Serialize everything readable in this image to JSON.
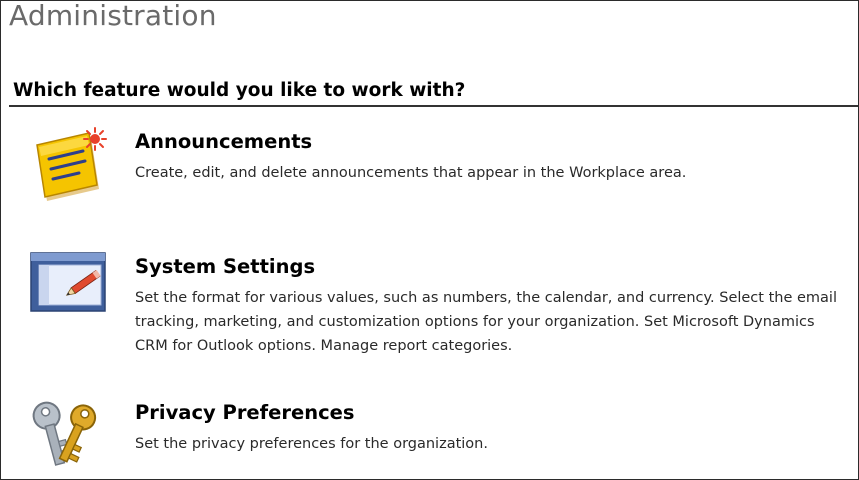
{
  "page": {
    "title": "Administration",
    "section_heading": "Which feature would you like to work with?"
  },
  "features": [
    {
      "icon": "announcements-note-icon",
      "title": "Announcements",
      "description": "Create, edit, and delete announcements that appear in the Workplace area."
    },
    {
      "icon": "system-settings-window-icon",
      "title": "System Settings",
      "description": "Set the format for various values, such as numbers, the calendar, and currency. Select the email tracking, marketing, and customization options for your organization. Set Microsoft Dynamics CRM for Outlook options. Manage report categories."
    },
    {
      "icon": "privacy-keys-icon",
      "title": "Privacy Preferences",
      "description": "Set the privacy preferences for the organization."
    }
  ],
  "colors": {
    "title_gray": "#6a6a6a",
    "heading_black": "#000000",
    "note_yellow": "#f5c400",
    "window_blue": "#3f5f9c",
    "key_gold": "#d9a21f",
    "key_silver": "#9aa3ad"
  }
}
